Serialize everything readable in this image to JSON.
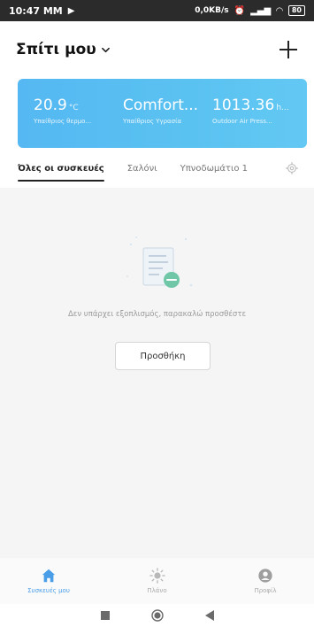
{
  "status_bar": {
    "time": "10:47 MM",
    "network_speed": "0,0KB/s",
    "battery": "80"
  },
  "header": {
    "home_name": "Σπίτι μου"
  },
  "weather": {
    "metrics": [
      {
        "value": "20.9",
        "unit": "°C",
        "label": "Υπαίθριος θερμο..."
      },
      {
        "value": "Comfort...",
        "unit": "",
        "label": "Υπαίθριος Υγρασία"
      },
      {
        "value": "1013.36",
        "unit": "h...",
        "label": "Outdoor Air Press..."
      }
    ]
  },
  "tabs": [
    {
      "label": "Όλες οι συσκευές",
      "active": true
    },
    {
      "label": "Σαλόνι",
      "active": false
    },
    {
      "label": "Υπνοδωμάτιο 1",
      "active": false
    }
  ],
  "empty_state": {
    "message": "Δεν υπάρχει εξοπλισμός, παρακαλώ προσθέστε",
    "button_label": "Προσθήκη"
  },
  "bottom_nav": [
    {
      "label": "Συσκευές μου",
      "icon": "home-icon",
      "active": true
    },
    {
      "label": "Πλάνο",
      "icon": "sun-icon",
      "active": false
    },
    {
      "label": "Προφίλ",
      "icon": "profile-icon",
      "active": false
    }
  ],
  "colors": {
    "card_gradient_start": "#55b8f2",
    "card_gradient_end": "#63c8f3",
    "accent": "#4a9ee8",
    "status_bar": "#2b2b2b"
  }
}
